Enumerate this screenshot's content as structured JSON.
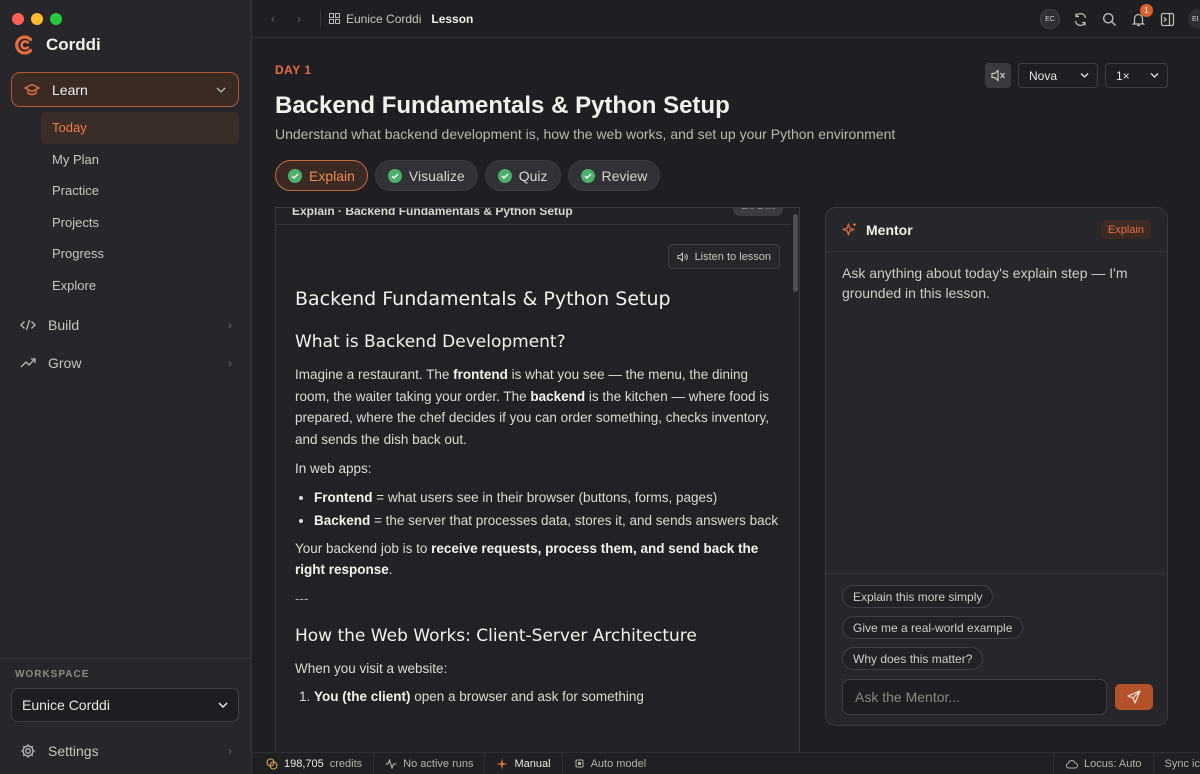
{
  "app": {
    "name": "Corddi",
    "accent": "#e56d3b"
  },
  "sidebar": {
    "learn_label": "Learn",
    "learn_items": [
      {
        "label": "Today",
        "active": true
      },
      {
        "label": "My Plan"
      },
      {
        "label": "Practice"
      },
      {
        "label": "Projects"
      },
      {
        "label": "Progress"
      },
      {
        "label": "Explore"
      }
    ],
    "build_label": "Build",
    "grow_label": "Grow",
    "workspace_label": "WORKSPACE",
    "workspace_value": "Eunice Corddi",
    "settings_label": "Settings"
  },
  "topbar": {
    "breadcrumb_workspace": "Eunice Corddi",
    "breadcrumb_current": "Lesson",
    "avatar_initials": "EC",
    "notification_count": "1",
    "edge_avatar": "EI"
  },
  "lesson": {
    "day_label": "DAY 1",
    "title": "Backend Fundamentals & Python Setup",
    "subtitle": "Understand what backend development is, how the web works, and set up your Python environment",
    "voice": "Nova",
    "speed": "1×",
    "tabs": [
      "Explain",
      "Visualize",
      "Quiz",
      "Review"
    ],
    "panel_header": "Explain · Backend Fundamentals & Python Setup",
    "panel_header_pill": "EXPLAIN",
    "listen_label": "Listen to lesson",
    "h1": "Backend Fundamentals & Python Setup",
    "h2_backend": "What is Backend Development?",
    "p_restaurant": {
      "a": "Imagine a restaurant. The ",
      "b": "frontend",
      "c": " is what you see — the menu, the dining room, the waiter taking your order. The ",
      "d": "backend",
      "e": " is the kitchen — where food is prepared, where the chef decides if you can order something, checks inventory, and sends the dish back out."
    },
    "p_webapps": "In web apps:",
    "bullets": [
      {
        "term": "Frontend",
        "text": " = what users see in their browser (buttons, forms, pages)"
      },
      {
        "term": "Backend",
        "text": " = the server that processes data, stores it, and sends answers back"
      }
    ],
    "p_job": {
      "a": "Your backend job is to ",
      "b": "receive requests, process them, and send back the right response",
      "c": "."
    },
    "hr": "---",
    "h2_web": "How the Web Works: Client-Server Architecture",
    "p_visit": "When you visit a website:",
    "ordered": [
      {
        "term": "You (the client)",
        "text": " open a browser and ask for something"
      }
    ]
  },
  "mentor": {
    "title": "Mentor",
    "pill": "Explain",
    "message": "Ask anything about today's explain step — I'm grounded in this lesson.",
    "chips": [
      "Explain this more simply",
      "Give me a real-world example",
      "Why does this matter?"
    ],
    "input_placeholder": "Ask the Mentor..."
  },
  "statusbar": {
    "credits_value": "198,705",
    "credits_label": "credits",
    "runs": "No active runs",
    "mode": "Manual",
    "model": "Auto model",
    "locus": "Locus: Auto",
    "sync": "Sync ic"
  }
}
